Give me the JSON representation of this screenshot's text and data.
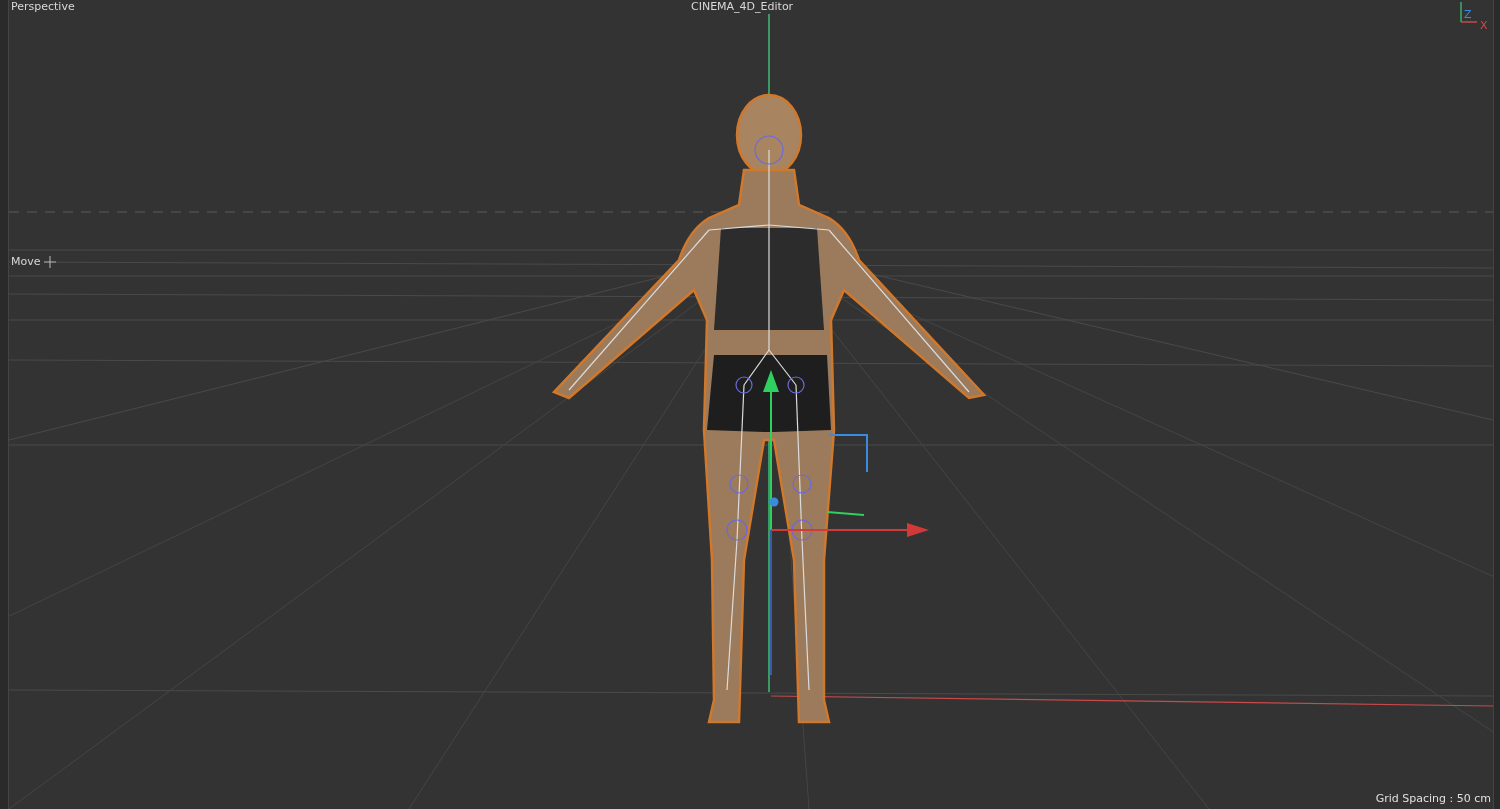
{
  "viewport": {
    "camera": "Perspective",
    "title": "CINEMA_4D_Editor",
    "tool": "Move",
    "grid_spacing": "Grid Spacing : 50 cm",
    "axis_labels": [
      "Z",
      "X"
    ]
  }
}
